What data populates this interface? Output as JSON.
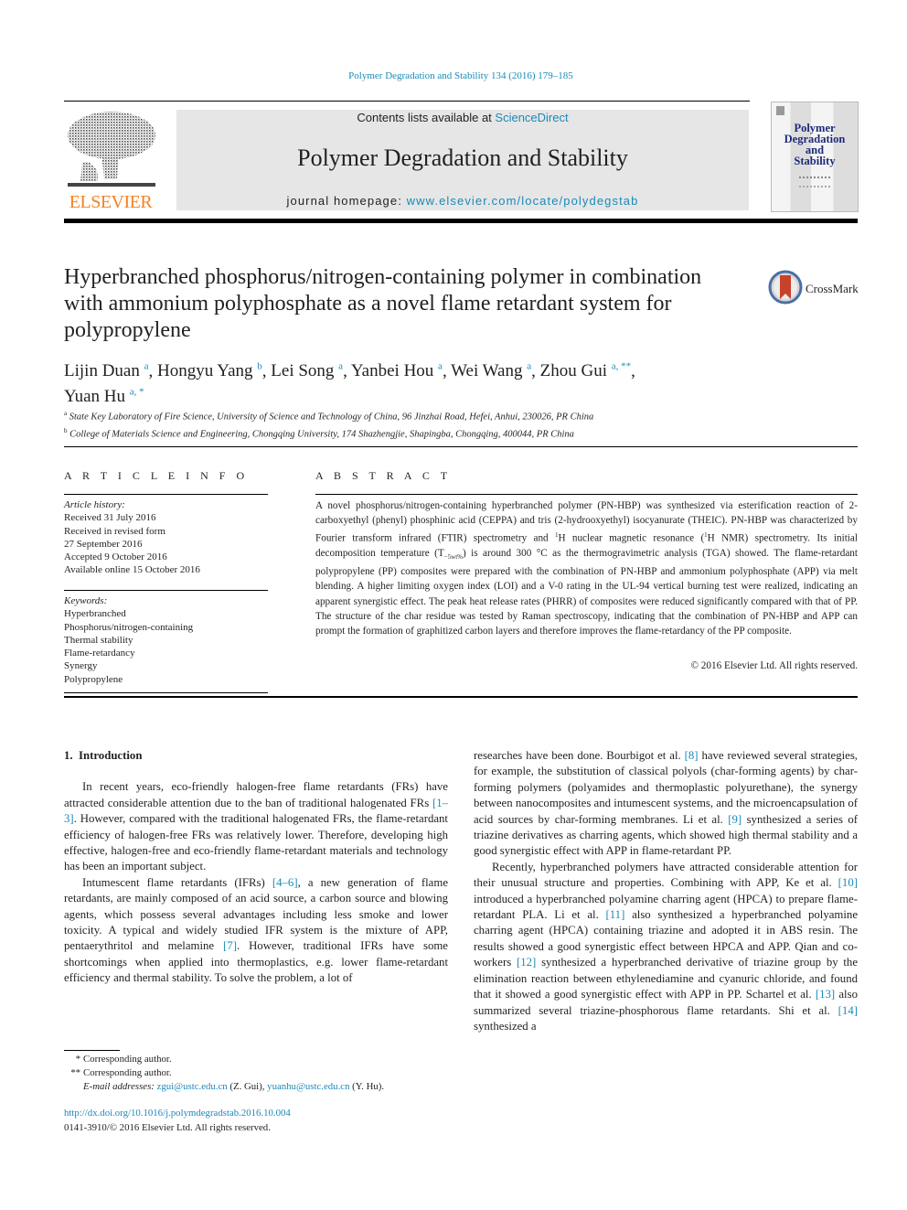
{
  "header": {
    "citation": "Polymer Degradation and Stability 134 (2016) 179–185",
    "contents_prefix": "Contents lists available at ",
    "contents_link": "ScienceDirect",
    "journal_name": "Polymer Degradation and Stability",
    "homepage_prefix": "journal homepage: ",
    "homepage_link": "www.elsevier.com/locate/polydegstab",
    "publisher_logo_text": "ELSEVIER",
    "cover_title": [
      "Polymer",
      "Degradation",
      "and",
      "Stability"
    ],
    "brand_colors": {
      "elsevier_orange": "#f58220",
      "link_blue": "#1a8ab8",
      "cover_navy": "#1e2a78"
    }
  },
  "crossmark": {
    "label": "CrossMark"
  },
  "article": {
    "title": "Hyperbranched phosphorus/nitrogen-containing polymer in combination with ammonium polyphosphate as a novel flame retardant system for polypropylene",
    "authors": [
      {
        "name": "Lijin Duan",
        "aff": "a"
      },
      {
        "name": "Hongyu Yang",
        "aff": "b"
      },
      {
        "name": "Lei Song",
        "aff": "a"
      },
      {
        "name": "Yanbei Hou",
        "aff": "a"
      },
      {
        "name": "Wei Wang",
        "aff": "a"
      },
      {
        "name": "Zhou Gui",
        "aff": "a, **"
      },
      {
        "name": "Yuan Hu",
        "aff": "a, *"
      }
    ],
    "affiliations": [
      {
        "mark": "a",
        "text": "State Key Laboratory of Fire Science, University of Science and Technology of China, 96 Jinzhai Road, Hefei, Anhui, 230026, PR China"
      },
      {
        "mark": "b",
        "text": "College of Materials Science and Engineering, Chongqing University, 174 Shazhengjie, Shapingba, Chongqing, 400044, PR China"
      }
    ]
  },
  "article_info": {
    "heading": "ARTICLE INFO",
    "history_label": "Article history:",
    "history": [
      "Received 31 July 2016",
      "Received in revised form",
      "27 September 2016",
      "Accepted 9 October 2016",
      "Available online 15 October 2016"
    ],
    "keywords_label": "Keywords:",
    "keywords": [
      "Hyperbranched",
      "Phosphorus/nitrogen-containing",
      "Thermal stability",
      "Flame-retardancy",
      "Synergy",
      "Polypropylene"
    ]
  },
  "abstract": {
    "heading": "ABSTRACT",
    "parts": {
      "p1": "A novel phosphorus/nitrogen-containing hyperbranched polymer (PN-HBP) was synthesized via esterification reaction of 2-carboxyethyl (phenyl) phosphinic acid (CEPPA) and tris (2-hydrooxyethyl) isocyanurate (THEIC). PN-HBP was characterized by Fourier transform infrared (FTIR) spectrometry and ",
      "sup1": "1",
      "p2": "H nuclear magnetic resonance (",
      "sup2": "1",
      "p3": "H NMR) spectrometry. Its initial decomposition temperature (T",
      "sub": "−5wt%",
      "p4": ") is around 300 °C as the thermogravimetric analysis (TGA) showed. The flame-retardant polypropylene (PP) composites were prepared with the combination of PN-HBP and ammonium polyphosphate (APP) via melt blending. A higher limiting oxygen index (LOI) and a V-0 rating in the UL-94 vertical burning test were realized, indicating an apparent synergistic effect. The peak heat release rates (PHRR) of composites were reduced significantly compared with that of PP. The structure of the char residue was tested by Raman spectroscopy, indicating that the combination of PN-HBP and APP can prompt the formation of graphitized carbon layers and therefore improves the flame-retardancy of the PP composite."
    },
    "copyright": "© 2016 Elsevier Ltd. All rights reserved."
  },
  "body": {
    "section_heading": "1.  Introduction",
    "left": {
      "para1": [
        {
          "t": "In recent years, eco-friendly halogen-free flame retardants (FRs) have attracted considerable attention due to the ban of traditional halogenated FRs "
        },
        {
          "ref": "[1–3]"
        },
        {
          "t": ". However, compared with the traditional halogenated FRs, the flame-retardant efficiency of halogen-free FRs was relatively lower. Therefore, developing high effective, halogen-free and eco-friendly flame-retardant materials and technology has been an important subject."
        }
      ],
      "para2": [
        {
          "t": "Intumescent flame retardants (IFRs) "
        },
        {
          "ref": "[4–6]"
        },
        {
          "t": ", a new generation of flame retardants, are mainly composed of an acid source, a carbon source and blowing agents, which possess several advantages including less smoke and lower toxicity. A typical and widely studied IFR system is the mixture of APP, pentaerythritol and melamine "
        },
        {
          "ref": "[7]"
        },
        {
          "t": ". However, traditional IFRs have some shortcomings when applied into thermoplastics, e.g. lower flame-retardant efficiency and thermal stability. To solve the problem, a lot of"
        }
      ]
    },
    "right": {
      "para1": [
        {
          "t": "researches have been done. Bourbigot et al. "
        },
        {
          "ref": "[8]"
        },
        {
          "t": " have reviewed several strategies, for example, the substitution of classical polyols (char-forming agents) by char-forming polymers (polyamides and thermoplastic polyurethane), the synergy between nanocomposites and intumescent systems, and the microencapsulation of acid sources by char-forming membranes. Li et al. "
        },
        {
          "ref": "[9]"
        },
        {
          "t": " synthesized a series of triazine derivatives as charring agents, which showed high thermal stability and a good synergistic effect with APP in flame-retardant PP."
        }
      ],
      "para2": [
        {
          "t": "Recently, hyperbranched polymers have attracted considerable attention for their unusual structure and properties. Combining with APP, Ke et al. "
        },
        {
          "ref": "[10]"
        },
        {
          "t": " introduced a hyperbranched polyamine charring agent (HPCA) to prepare flame-retardant PLA. Li et al. "
        },
        {
          "ref": "[11]"
        },
        {
          "t": " also synthesized a hyperbranched polyamine charring agent (HPCA) containing triazine and adopted it in ABS resin. The results showed a good synergistic effect between HPCA and APP. Qian and co-workers "
        },
        {
          "ref": "[12]"
        },
        {
          "t": " synthesized a hyperbranched derivative of triazine group by the elimination reaction between ethylenediamine and cyanuric chloride, and found that it showed a good synergistic effect with APP in PP. Schartel et al. "
        },
        {
          "ref": "[13]"
        },
        {
          "t": " also summarized several triazine-phosphorous flame retardants. Shi et al. "
        },
        {
          "ref": "[14]"
        },
        {
          "t": " synthesized a"
        }
      ]
    }
  },
  "footnotes": {
    "items": [
      {
        "mark": "*",
        "text": "Corresponding author."
      },
      {
        "mark": "**",
        "text": "Corresponding author."
      }
    ],
    "email_label": "E-mail addresses:",
    "emails": [
      {
        "address": "zgui@ustc.edu.cn",
        "who": " (Z. Gui), "
      },
      {
        "address": "yuanhu@ustc.edu.cn",
        "who": " (Y. Hu)."
      }
    ],
    "doi": "http://dx.doi.org/10.1016/j.polymdegradstab.2016.10.004",
    "issn_line": "0141-3910/© 2016 Elsevier Ltd. All rights reserved."
  }
}
